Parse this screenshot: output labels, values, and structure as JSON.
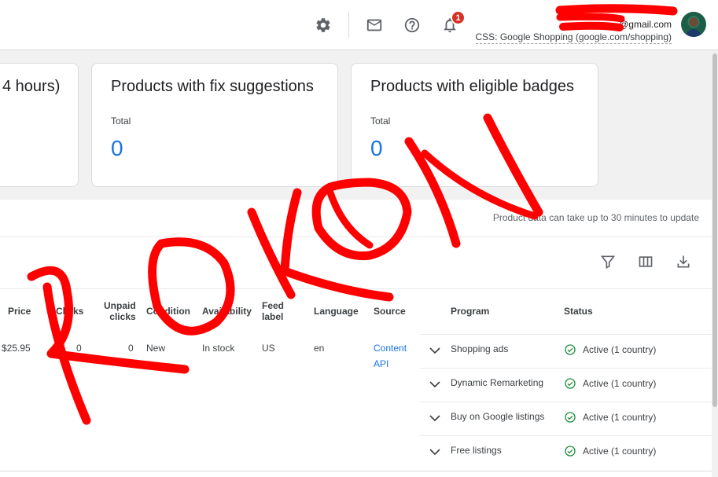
{
  "header": {
    "icons": {
      "settings": "gear-icon",
      "mail": "mail-icon",
      "help": "help-icon",
      "notifications": "bell-icon"
    },
    "notification_count": "1",
    "account_email": "@gmail.com",
    "account_css": "CSS: Google Shopping (google.com/shopping)"
  },
  "cards": [
    {
      "title": "4 hours)"
    },
    {
      "title": "Products with fix suggestions",
      "sub": "Total",
      "value": "0"
    },
    {
      "title": "Products with eligible badges",
      "sub": "Total",
      "value": "0"
    }
  ],
  "panel": {
    "note": "Product data can take up to 30 minutes to update",
    "tools": [
      "filter-icon",
      "columns-icon",
      "download-icon"
    ]
  },
  "table": {
    "headers": {
      "price": "Price",
      "clicks": "Clicks",
      "unpaid_1": "Unpaid",
      "unpaid_2": "clicks",
      "condition": "Condition",
      "availability": "Availability",
      "feed_1": "Feed",
      "feed_2": "label",
      "language": "Language",
      "source": "Source",
      "program": "Program",
      "status": "Status"
    },
    "row": {
      "price": "$25.95",
      "clicks": "0",
      "unpaid_clicks": "0",
      "condition": "New",
      "availability": "In stock",
      "feed_label": "US",
      "language": "en",
      "source_1": "Content",
      "source_2": "API"
    },
    "programs": [
      {
        "name": "Shopping ads",
        "status": "Active (1 country)"
      },
      {
        "name": "Dynamic Remarketing",
        "status": "Active (1 country)"
      },
      {
        "name": "Buy on Google listings",
        "status": "Active (1 country)"
      },
      {
        "name": "Free listings",
        "status": "Active (1 country)"
      }
    ]
  },
  "colors": {
    "accent": "#1a73e8",
    "status_green": "#1e8e3e",
    "badge_red": "#d93025",
    "scribble": "#ff0000"
  }
}
